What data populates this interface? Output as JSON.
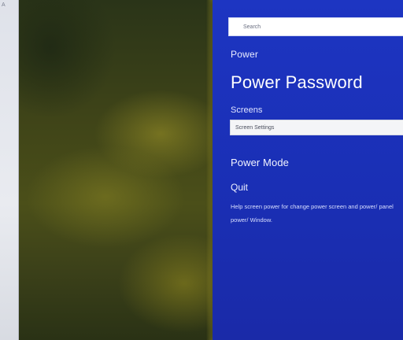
{
  "rail": {
    "mark": "A"
  },
  "panel": {
    "search_placeholder": "Search",
    "small_label": "Power",
    "title": "Power Password",
    "section_label": "Screens",
    "combo_value": "Screen Settings",
    "sub_heading": "Power Mode",
    "small_heading": "Quit",
    "description": "Help screen power for change power screen and power/ panel power/ Window."
  },
  "colors": {
    "panel_blue": "#1d35c2",
    "wallpaper_olive": "#4b4f19",
    "rail_gray": "#e3e6ec"
  }
}
